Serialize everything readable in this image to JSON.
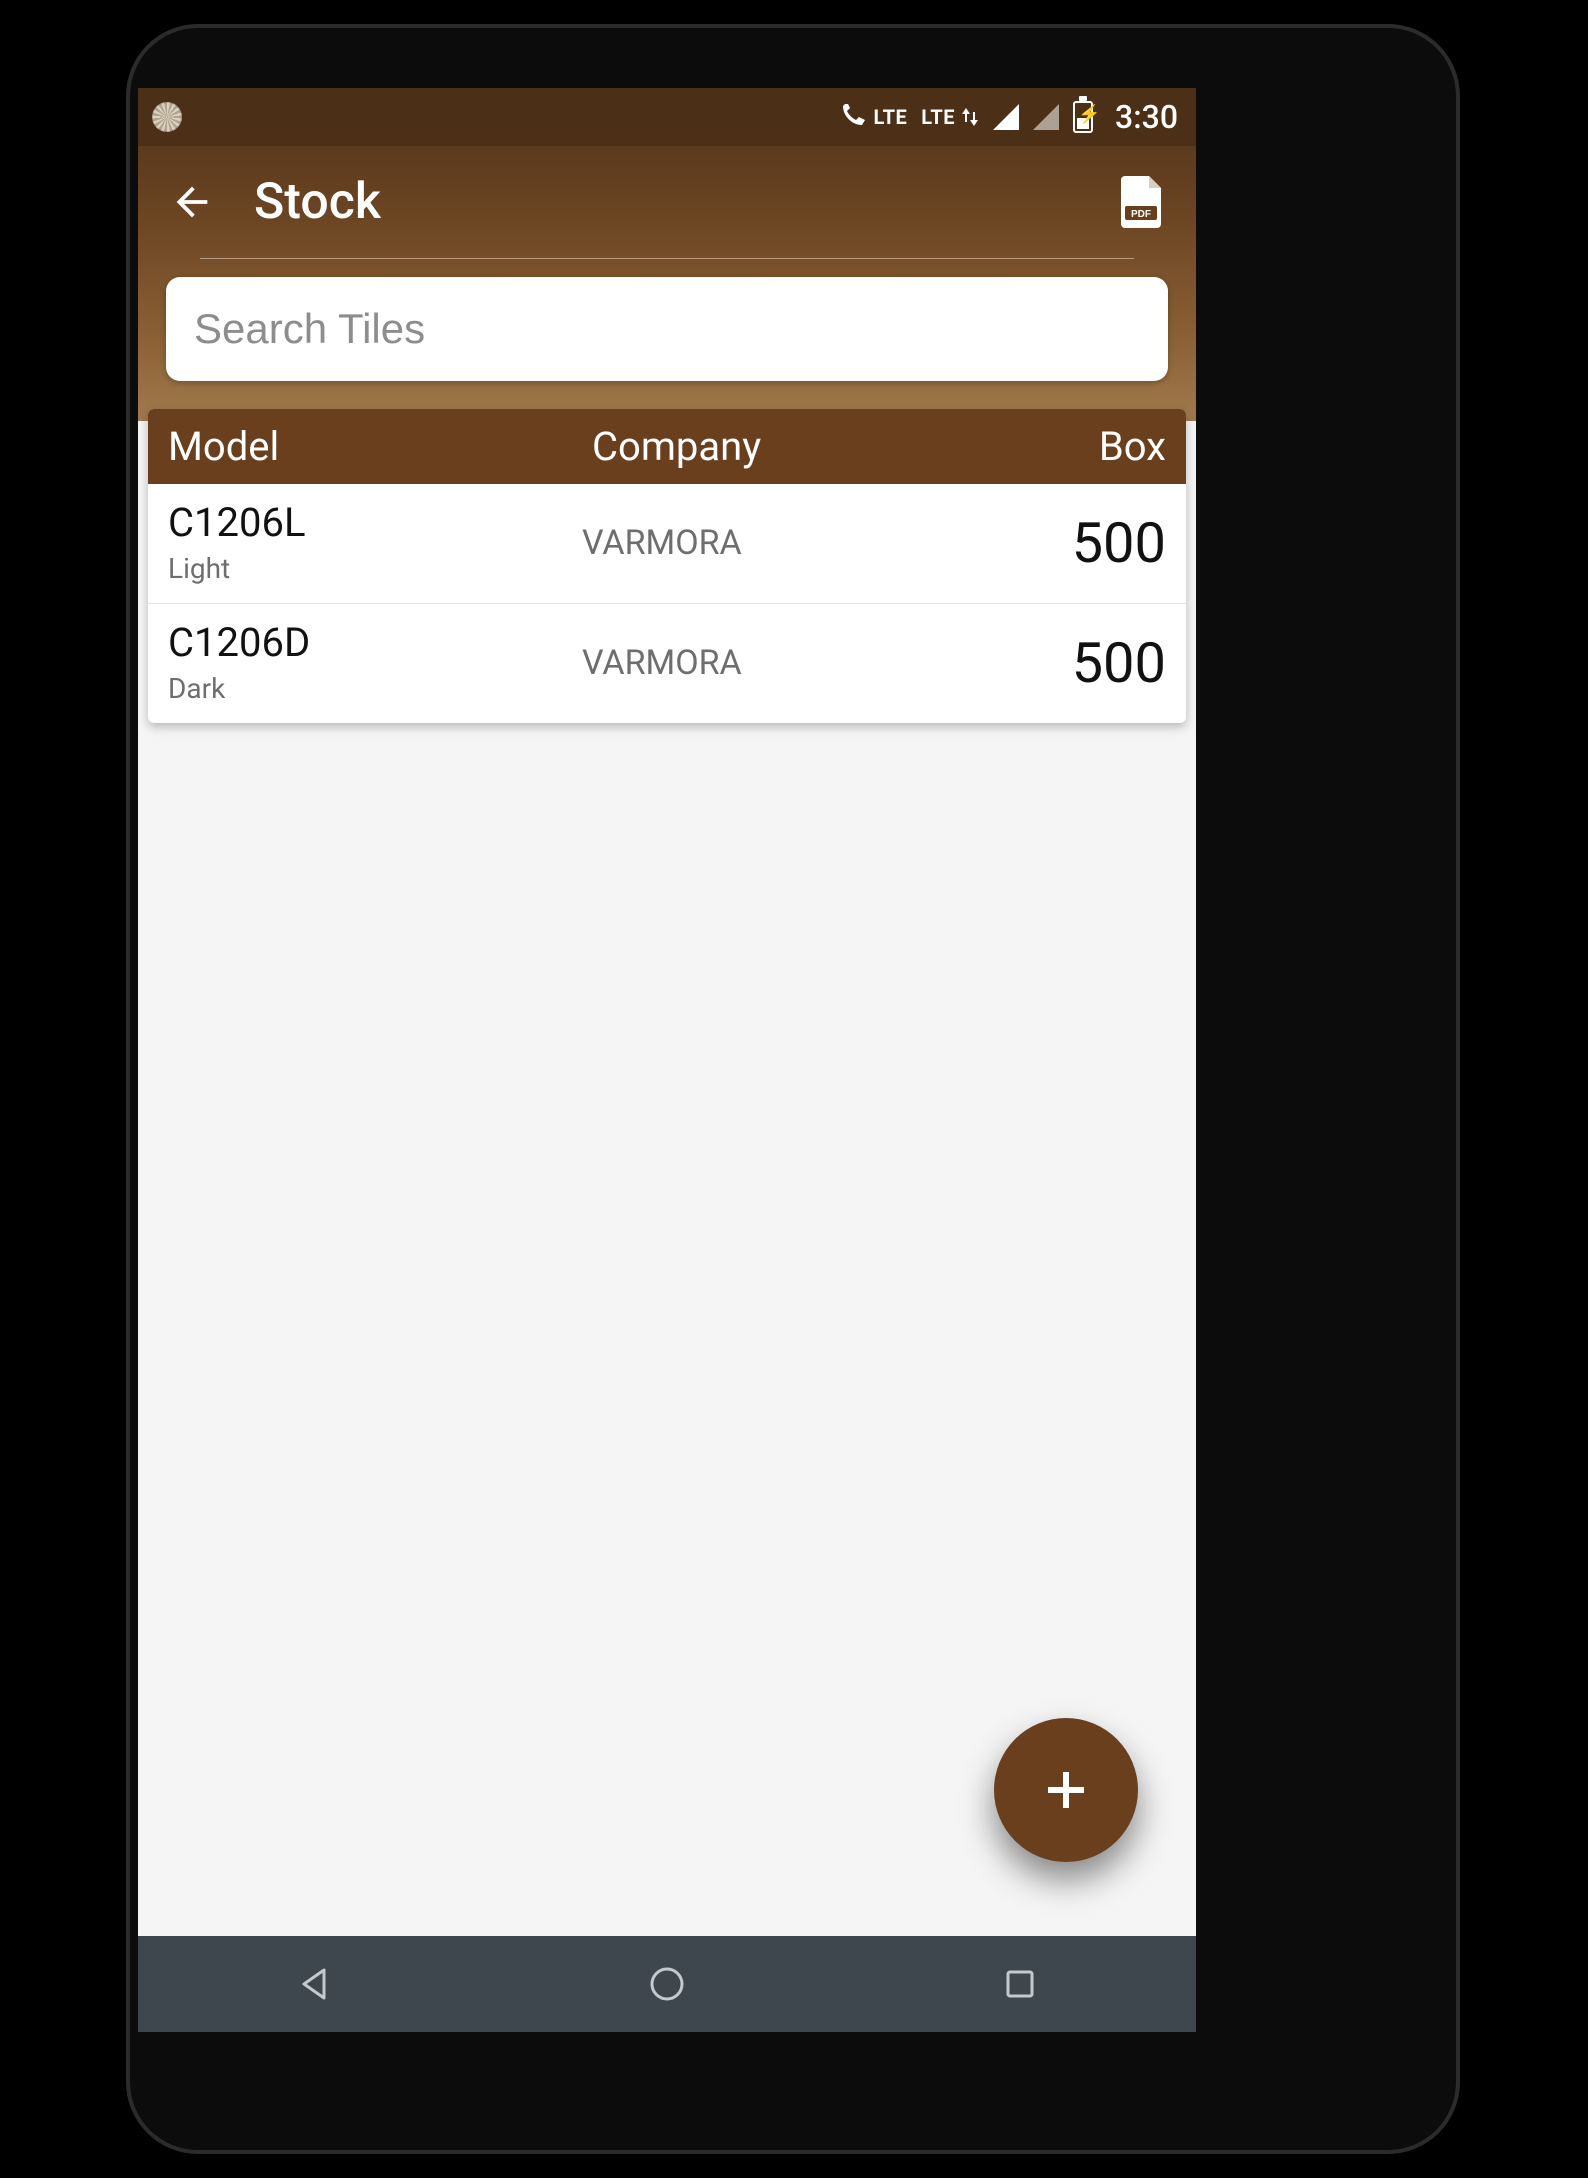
{
  "status": {
    "time": "3:30",
    "lte1": "LTE",
    "lte2": "LTE"
  },
  "header": {
    "title": "Stock"
  },
  "search": {
    "placeholder": "Search Tiles",
    "value": ""
  },
  "table": {
    "headers": {
      "model": "Model",
      "company": "Company",
      "box": "Box"
    },
    "rows": [
      {
        "model": "C1206L",
        "variant": "Light",
        "company": "VARMORA",
        "box": "500"
      },
      {
        "model": "C1206D",
        "variant": "Dark",
        "company": "VARMORA",
        "box": "500"
      }
    ]
  },
  "colors": {
    "brand_brown_dark": "#5c3a1d",
    "brand_brown": "#6a3f1e",
    "brand_brown_light": "#a07a4e",
    "navbar": "#3e474d"
  }
}
